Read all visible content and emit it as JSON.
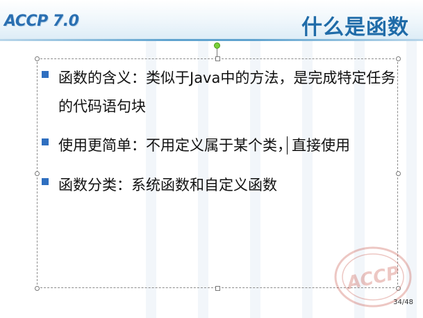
{
  "slide": {
    "logo_text": "ACCP 7.0",
    "title": "什么是函数",
    "bullets": [
      {
        "text": "函数的含义：类似于Java中的方法，是完成特定任务的代码语句块"
      },
      {
        "text": "使用更简单：不用定义属于某个类，直接使用"
      },
      {
        "text": "函数分类：系统函数和自定义函数"
      }
    ],
    "page_number": "34/48",
    "watermark_logo": "ACCP"
  },
  "colors": {
    "title": "#1f6ba8",
    "logo": "#2a6fb1",
    "bullet": "#2f6fc0",
    "rotate_handle": "#7ad03a",
    "stamp": "#c0392b"
  },
  "icons": {
    "bullet": "square-bullet-icon",
    "rotate": "rotate-handle-icon",
    "resize": "resize-handle-icon",
    "watermark": "accp-stamp-icon"
  }
}
